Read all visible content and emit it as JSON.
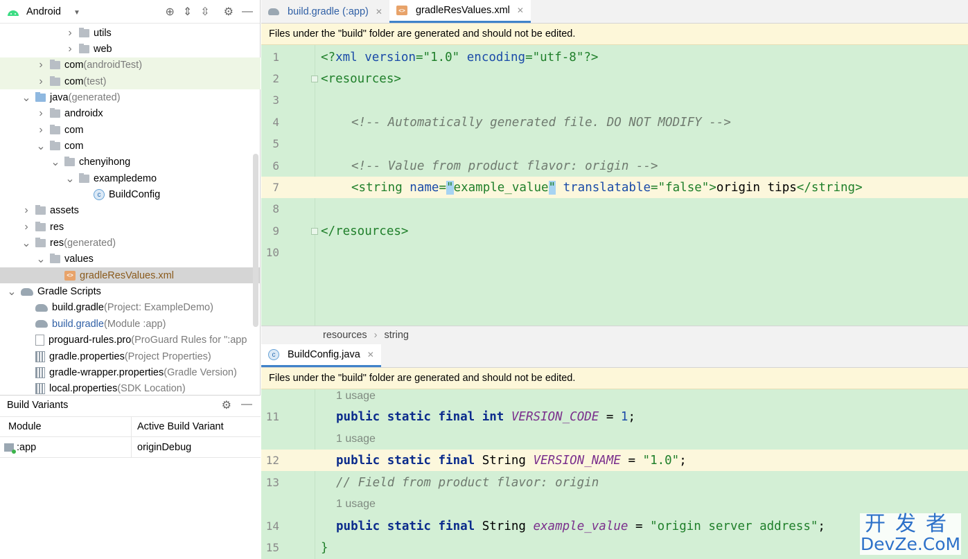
{
  "project_panel": {
    "view_selector": "Android",
    "tree": [
      {
        "label": "utils",
        "suffix": "",
        "indent": 4,
        "arrow": "right",
        "icon": "folder"
      },
      {
        "label": "web",
        "suffix": "",
        "indent": 4,
        "arrow": "right",
        "icon": "folder"
      },
      {
        "label": "com",
        "suffix": " (androidTest)",
        "indent": 2,
        "arrow": "right",
        "icon": "folder"
      },
      {
        "label": "com",
        "suffix": " (test)",
        "indent": 2,
        "arrow": "right",
        "icon": "folder"
      },
      {
        "label": "java",
        "suffix": " (generated)",
        "indent": 1,
        "arrow": "down",
        "icon": "folder-blue"
      },
      {
        "label": "androidx",
        "suffix": "",
        "indent": 2,
        "arrow": "right",
        "icon": "folder"
      },
      {
        "label": "com",
        "suffix": "",
        "indent": 2,
        "arrow": "right",
        "icon": "folder"
      },
      {
        "label": "com",
        "suffix": "",
        "indent": 2,
        "arrow": "down",
        "icon": "folder"
      },
      {
        "label": "chenyihong",
        "suffix": "",
        "indent": 3,
        "arrow": "down",
        "icon": "folder"
      },
      {
        "label": "exampledemo",
        "suffix": "",
        "indent": 4,
        "arrow": "down",
        "icon": "folder"
      },
      {
        "label": "BuildConfig",
        "suffix": "",
        "indent": 5,
        "arrow": "none",
        "icon": "class"
      },
      {
        "label": "assets",
        "suffix": "",
        "indent": 1,
        "arrow": "right",
        "icon": "folder"
      },
      {
        "label": "res",
        "suffix": "",
        "indent": 1,
        "arrow": "right",
        "icon": "folder"
      },
      {
        "label": "res",
        "suffix": " (generated)",
        "indent": 1,
        "arrow": "down",
        "icon": "folder"
      },
      {
        "label": "values",
        "suffix": "",
        "indent": 2,
        "arrow": "down",
        "icon": "folder"
      },
      {
        "label": "gradleResValues.xml",
        "suffix": "",
        "indent": 3,
        "arrow": "none",
        "icon": "xml"
      },
      {
        "label": "Gradle Scripts",
        "suffix": "",
        "indent": 0,
        "arrow": "down",
        "icon": "gradle"
      },
      {
        "label": "build.gradle",
        "suffix": " (Project: ExampleDemo)",
        "indent": 1,
        "arrow": "none",
        "icon": "gradle"
      },
      {
        "label": "build.gradle",
        "suffix": " (Module :app)",
        "indent": 1,
        "arrow": "none",
        "icon": "gradle"
      },
      {
        "label": "proguard-rules.pro",
        "suffix": " (ProGuard Rules for \":app",
        "indent": 1,
        "arrow": "none",
        "icon": "file"
      },
      {
        "label": "gradle.properties",
        "suffix": " (Project Properties)",
        "indent": 1,
        "arrow": "none",
        "icon": "props"
      },
      {
        "label": "gradle-wrapper.properties",
        "suffix": " (Gradle Version)",
        "indent": 1,
        "arrow": "none",
        "icon": "props"
      },
      {
        "label": "local.properties",
        "suffix": " (SDK Location)",
        "indent": 1,
        "arrow": "none",
        "icon": "props"
      }
    ]
  },
  "build_variants": {
    "title": "Build Variants",
    "col_module": "Module",
    "col_variant": "Active Build Variant",
    "module": ":app",
    "variant": "originDebug"
  },
  "top_editor": {
    "tabs": [
      {
        "label": "build.gradle (:app)"
      },
      {
        "label": "gradleResValues.xml"
      }
    ],
    "banner": "Files under the \"build\" folder are generated and should not be edited.",
    "breadcrumb": [
      "resources",
      "string"
    ],
    "line_numbers": [
      "1",
      "2",
      "3",
      "4",
      "5",
      "6",
      "7",
      "8",
      "9",
      "10"
    ],
    "code": {
      "l1_a": "<?",
      "l1_b": "xml ",
      "l1_c": "version",
      "l1_d": "=\"1.0\" ",
      "l1_e": "encoding",
      "l1_f": "=\"utf-8\"",
      "l1_g": "?>",
      "l2": "<resources>",
      "l4": "<!-- Automatically generated file. DO NOT MODIFY -->",
      "l6": "<!-- Value from product flavor: origin -->",
      "l7_tag": "<string ",
      "l7_name": "name",
      "l7_eq": "=",
      "l7_q1": "\"",
      "l7_nameval": "example_value",
      "l7_q2": "\"",
      "l7_trans": " translatable",
      "l7_transval": "=\"false\"",
      "l7_close": ">",
      "l7_text": "origin tips",
      "l7_end": "</string>",
      "l9": "</resources>"
    }
  },
  "bottom_editor": {
    "tab": "BuildConfig.java",
    "banner": "Files under the \"build\" folder are generated and should not be edited.",
    "usage": "1 usage",
    "line_numbers": [
      "11",
      "12",
      "13",
      "14",
      "15"
    ],
    "code": {
      "kw": "public static final ",
      "int": "int ",
      "f1": "VERSION_CODE",
      "eq": " = ",
      "v1": "1",
      "semi": ";",
      "string": "String ",
      "f2": "VERSION_NAME",
      "v2": "\"1.0\"",
      "comment": "// Field from product flavor: origin",
      "f3": "example_value",
      "v3": "\"origin server address\"",
      "close": "}"
    }
  },
  "watermark": {
    "line1": "开发者",
    "line2": "DevZe.CoM"
  }
}
